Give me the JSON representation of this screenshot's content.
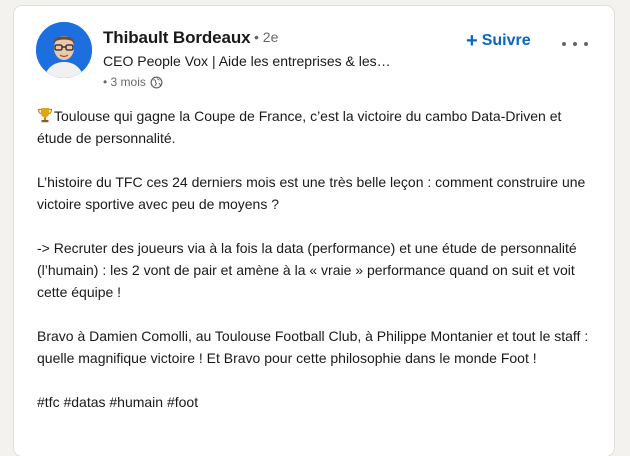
{
  "post": {
    "author_name": "Thibault Bordeaux",
    "connection_degree": "• 2e",
    "headline": "CEO People Vox | Aide les entreprises & les…",
    "time": "• 3 mois",
    "follow_label": "Suivre",
    "paragraphs": [
      "Toulouse qui gagne la Coupe de France, c’est la victoire du cambo Data-Driven et étude de personnalité.",
      "L’histoire du TFC ces 24 derniers mois est une très belle leçon : comment construire une victoire sportive avec peu de moyens ?",
      "-> Recruter des joueurs via à la fois la data (performance) et une étude de personnalité (l’humain) : les 2 vont de pair et amène à la « vraie » performance quand on suit et voit cette équipe !",
      "Bravo à Damien Comolli, au Toulouse Football Club, à Philippe Montanier et tout le staff : quelle magnifique victoire ! Et Bravo pour cette philosophie dans le monde Foot !",
      "#tfc #datas #humain #foot"
    ]
  },
  "icons": {
    "trophy": "trophy-icon",
    "globe": "globe-icon",
    "more": "more-options-icon",
    "plus": "plus-icon"
  },
  "colors": {
    "accent": "#0a66c2",
    "avatar_bg": "#1d6fe0"
  }
}
